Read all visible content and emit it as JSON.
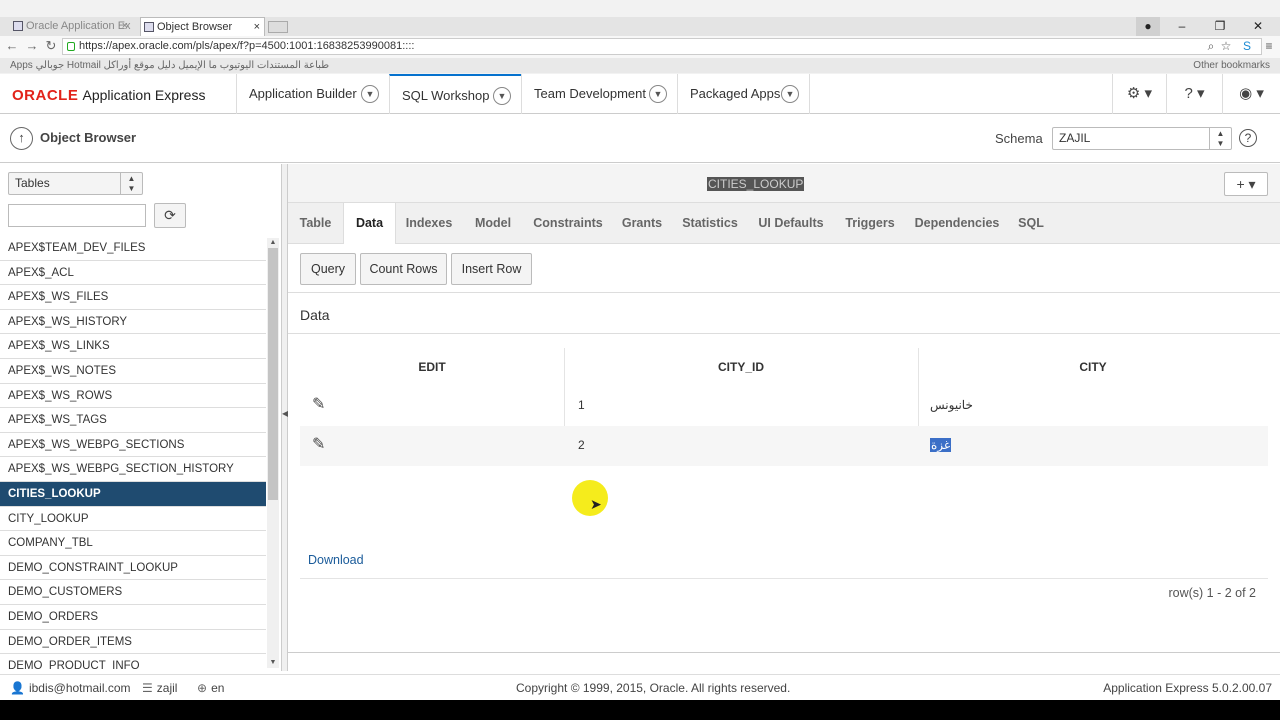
{
  "browser": {
    "tabs": [
      {
        "label": "Oracle Application Ex",
        "active": false
      },
      {
        "label": "Object Browser",
        "active": true
      }
    ],
    "url": "https://apex.oracle.com/pls/apex/f?p=4500:1001:16838253990081::::",
    "bookmarks_text": "Apps   جوبالي   Hotmail   طباعة المستندات   اليوتيوب   ما الإيميل   دليل   موقع أوراكل",
    "bookmarks_right": "Other bookmarks"
  },
  "topnav": {
    "brand": "ORACLE",
    "product": "Application Express",
    "tabs": [
      {
        "label": "Application Builder"
      },
      {
        "label": "SQL Workshop",
        "active": true
      },
      {
        "label": "Team Development"
      },
      {
        "label": "Packaged Apps"
      }
    ]
  },
  "titlebar": {
    "title": "Object Browser",
    "schema_label": "Schema",
    "schema_value": "ZAJIL"
  },
  "sidebar": {
    "object_type": "Tables",
    "filter_value": "",
    "objects": [
      "APEX$TEAM_DEV_FILES",
      "APEX$_ACL",
      "APEX$_WS_FILES",
      "APEX$_WS_HISTORY",
      "APEX$_WS_LINKS",
      "APEX$_WS_NOTES",
      "APEX$_WS_ROWS",
      "APEX$_WS_TAGS",
      "APEX$_WS_WEBPG_SECTIONS",
      "APEX$_WS_WEBPG_SECTION_HISTORY",
      "CITIES_LOOKUP",
      "CITY_LOOKUP",
      "COMPANY_TBL",
      "DEMO_CONSTRAINT_LOOKUP",
      "DEMO_CUSTOMERS",
      "DEMO_ORDERS",
      "DEMO_ORDER_ITEMS",
      "DEMO_PRODUCT_INFO"
    ],
    "selected": "CITIES_LOOKUP"
  },
  "main": {
    "object_name": "CITIES_LOOKUP",
    "tabs": [
      "Table",
      "Data",
      "Indexes",
      "Model",
      "Constraints",
      "Grants",
      "Statistics",
      "UI Defaults",
      "Triggers",
      "Dependencies",
      "SQL"
    ],
    "active_tab": "Data",
    "actions": [
      "Query",
      "Count Rows",
      "Insert Row"
    ],
    "region_title": "Data",
    "columns": [
      "EDIT",
      "CITY_ID",
      "CITY"
    ],
    "rows": [
      {
        "city_id": "1",
        "city": "خانيونس"
      },
      {
        "city_id": "2",
        "city": "غزة"
      }
    ],
    "download_label": "Download",
    "row_count": "row(s) 1 - 2 of 2"
  },
  "footer": {
    "user": "ibdis@hotmail.com",
    "workspace": "zajil",
    "language": "en",
    "copyright": "Copyright © 1999, 2015, Oracle. All rights reserved.",
    "version": "Application Express 5.0.2.00.07"
  },
  "colors": {
    "brand_red": "#e2231a",
    "selected_row": "#1f4b70",
    "link": "#1a5b9a",
    "cursor_highlight": "#f5ec1c"
  }
}
